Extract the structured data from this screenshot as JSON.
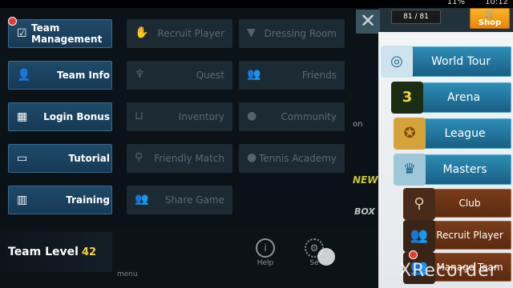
{
  "status": {
    "battery": "11%",
    "time": "10:12"
  },
  "hud": {
    "stamina": "81 / 81",
    "shop_label": "Shop"
  },
  "left_menu": [
    {
      "label": "Team Management",
      "icon": "clipboard-icon"
    },
    {
      "label": "Team Info",
      "icon": "person-icon"
    },
    {
      "label": "Login Bonus",
      "icon": "calendar-icon"
    },
    {
      "label": "Tutorial",
      "icon": "book-icon"
    },
    {
      "label": "Training",
      "icon": "court-icon"
    }
  ],
  "mid_menu": [
    {
      "label": "Recruit Player",
      "icon": "handshake-icon"
    },
    {
      "label": "Dressing Room",
      "icon": "shirt-icon"
    },
    {
      "label": "Quest",
      "icon": "trophy-icon"
    },
    {
      "label": "Friends",
      "icon": "friends-icon"
    },
    {
      "label": "Inventory",
      "icon": "inbox-icon"
    },
    {
      "label": "Community",
      "icon": "chat-icon"
    },
    {
      "label": "Friendly Match",
      "icon": "racket-icon"
    },
    {
      "label": "Tennis Academy",
      "icon": "academy-icon"
    },
    {
      "label": "Share Game",
      "icon": "share-icon"
    }
  ],
  "team_level": {
    "label": "Team Level",
    "value": "42"
  },
  "bottom": {
    "help": "Help",
    "settings": "Se"
  },
  "right_menu": [
    {
      "label": "World Tour",
      "icon": "globe-icon"
    },
    {
      "label": "Arena",
      "icon": "arena-icon",
      "badge": "3"
    },
    {
      "label": "League",
      "icon": "medal-icon"
    },
    {
      "label": "Masters",
      "icon": "masters-icon"
    },
    {
      "label": "Club",
      "icon": "racket-icon"
    },
    {
      "label": "Recruit Player",
      "icon": "players-icon"
    },
    {
      "label": "Manage Team",
      "icon": "team-icon"
    }
  ],
  "bg_fragments": {
    "new": "NEW",
    "box": "BOX",
    "on": "on",
    "menu": "menu"
  },
  "watermark": "XRecorder"
}
